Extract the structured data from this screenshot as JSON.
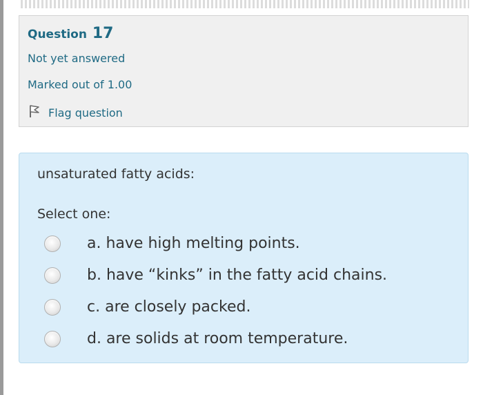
{
  "question_info": {
    "title_label": "Question",
    "number": "17",
    "status": "Not yet answered",
    "marked": "Marked out of 1.00",
    "flag_label": "Flag question"
  },
  "question": {
    "text": "unsaturated fatty acids:",
    "prompt": "Select one:",
    "options": [
      {
        "label": "a. have high melting points."
      },
      {
        "label": "b. have “kinks” in the fatty acid chains."
      },
      {
        "label": "c. are closely packed."
      },
      {
        "label": "d. are solids at room temperature."
      }
    ]
  },
  "icons": {
    "flag": "flag-icon",
    "radio": "radio-button"
  },
  "colors": {
    "accent_text": "#1f6a84",
    "info_bg": "#f0f0f0",
    "question_bg": "#dbeefa"
  }
}
